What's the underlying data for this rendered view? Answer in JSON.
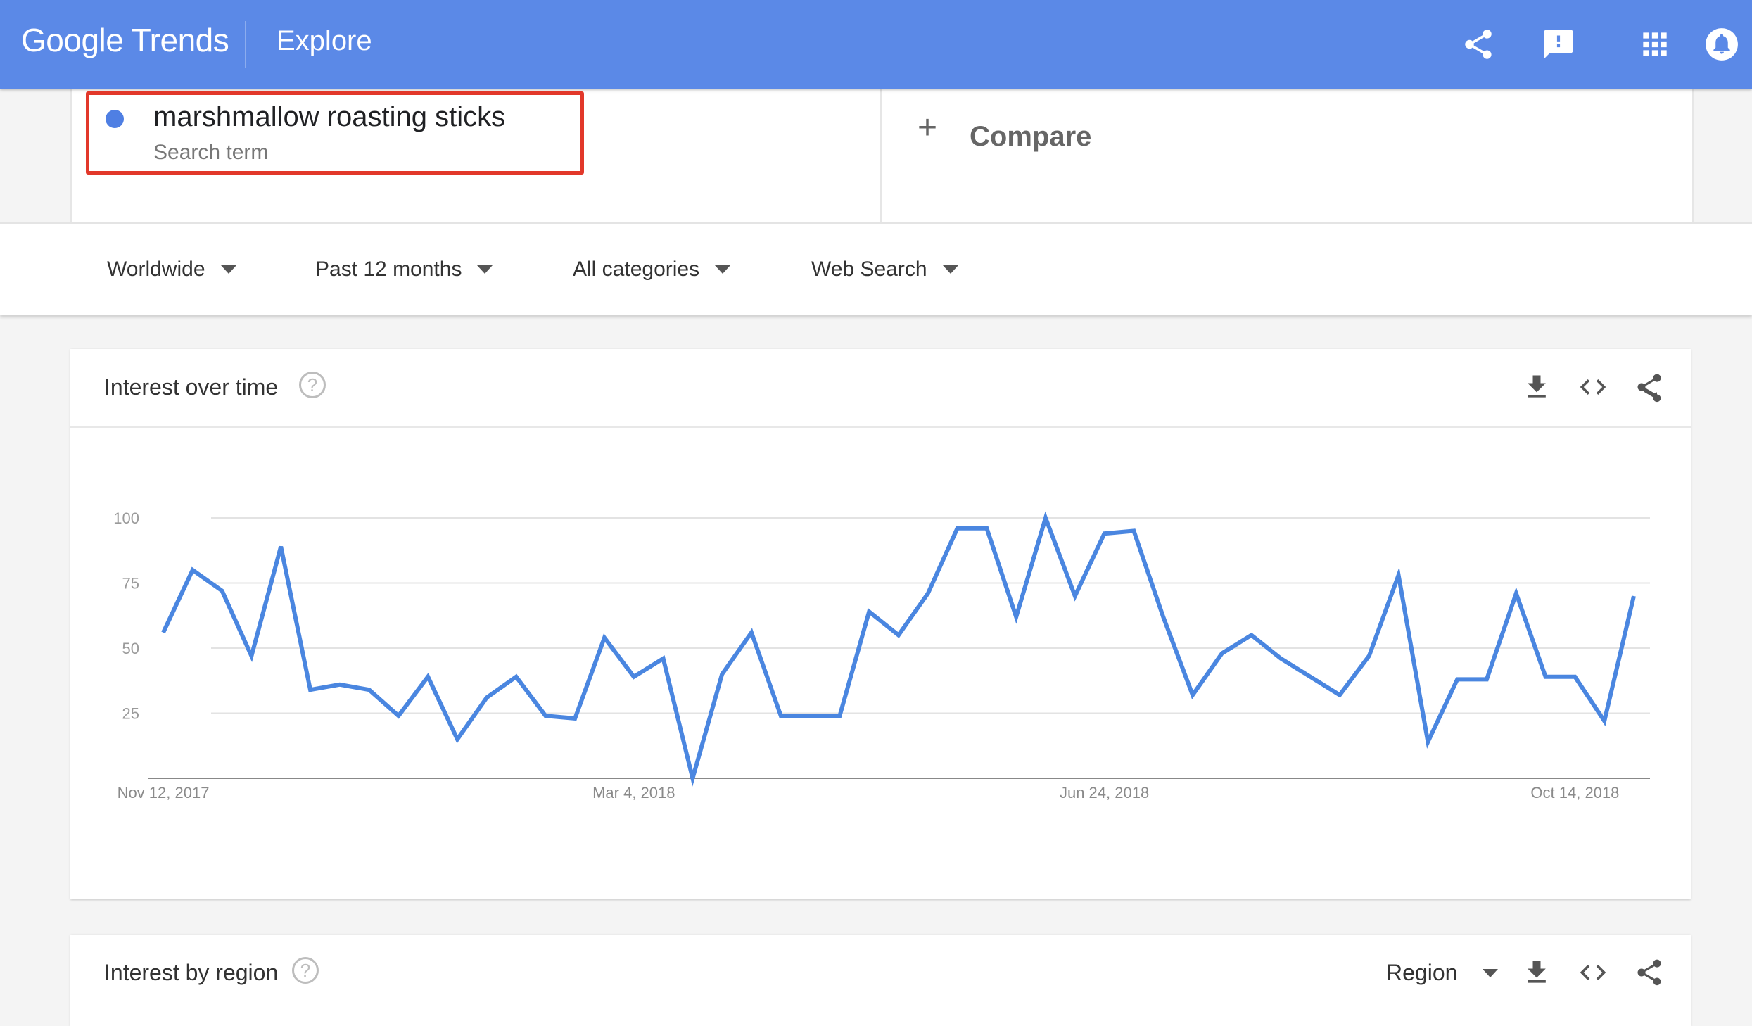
{
  "header": {
    "logo_text": "Google Trends",
    "section": "Explore",
    "icons": [
      "share-icon",
      "feedback-icon",
      "apps-icon",
      "notifications-icon"
    ],
    "bg_color": "#5b89e7"
  },
  "search_term": {
    "term": "marshmallow roasting sticks",
    "label": "Search term",
    "dot_color": "#4f7fe3",
    "highlight_color": "#e2382a"
  },
  "compare": {
    "label": "Compare"
  },
  "filters": [
    {
      "label": "Worldwide"
    },
    {
      "label": "Past 12 months"
    },
    {
      "label": "All categories"
    },
    {
      "label": "Web Search"
    }
  ],
  "interest_over_time": {
    "title": "Interest over time",
    "help": "?"
  },
  "interest_by_region": {
    "title": "Interest by region",
    "help": "?",
    "region_select": "Region"
  },
  "chart_data": {
    "type": "line",
    "line_color": "#4a86e0",
    "grid": true,
    "ylim": [
      0,
      100
    ],
    "y_ticks": [
      "100",
      "75",
      "50",
      "25"
    ],
    "x_tick_labels": [
      "Nov 12, 2017",
      "Mar 4, 2018",
      "Jun 24, 2018",
      "Oct 14, 2018"
    ],
    "x_tick_indices": [
      0,
      16,
      32,
      48
    ],
    "series": [
      {
        "values": [
          56,
          80,
          72,
          47,
          89,
          34,
          36,
          34,
          24,
          39,
          15,
          31,
          39,
          24,
          23,
          54,
          39,
          46,
          0,
          40,
          56,
          24,
          24,
          24,
          64,
          55,
          71,
          96,
          96,
          62,
          100,
          70,
          94,
          95,
          62,
          32,
          48,
          55,
          46,
          39,
          32,
          47,
          78,
          14,
          38,
          38,
          71,
          39,
          39,
          22,
          70
        ]
      }
    ]
  }
}
